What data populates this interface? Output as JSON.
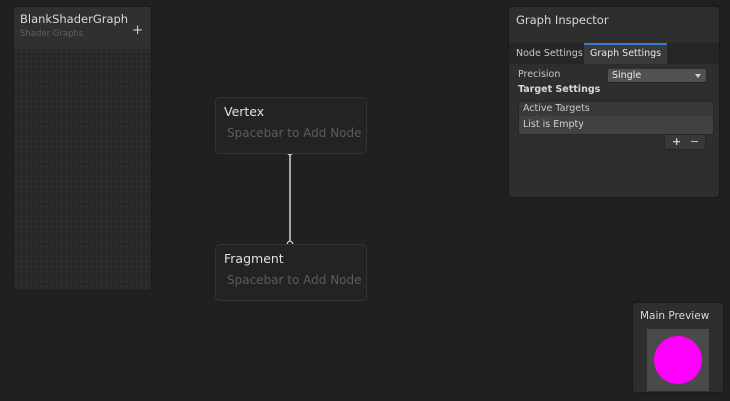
{
  "blackboard": {
    "title": "BlankShaderGraph",
    "subtitle": "Shader Graphs",
    "add_label": "+"
  },
  "master_stack": {
    "vertex": {
      "title": "Vertex",
      "hint": "Spacebar to Add Node"
    },
    "fragment": {
      "title": "Fragment",
      "hint": "Spacebar to Add Node"
    },
    "connector_color": "#d4d4d4"
  },
  "inspector": {
    "title": "Graph Inspector",
    "tabs": [
      {
        "label": "Node Settings",
        "active": false
      },
      {
        "label": "Graph Settings",
        "active": true
      }
    ],
    "precision": {
      "label": "Precision",
      "value": "Single"
    },
    "target_settings": {
      "label": "Target Settings",
      "list_header": "Active Targets",
      "list_empty": "List is Empty",
      "add_label": "+",
      "remove_label": "−"
    }
  },
  "preview": {
    "title": "Main Preview",
    "sphere_color": "#ff00ff"
  },
  "colors": {
    "background": "#202020",
    "panel": "#2e2e2e",
    "accent": "#3a7bd5"
  }
}
